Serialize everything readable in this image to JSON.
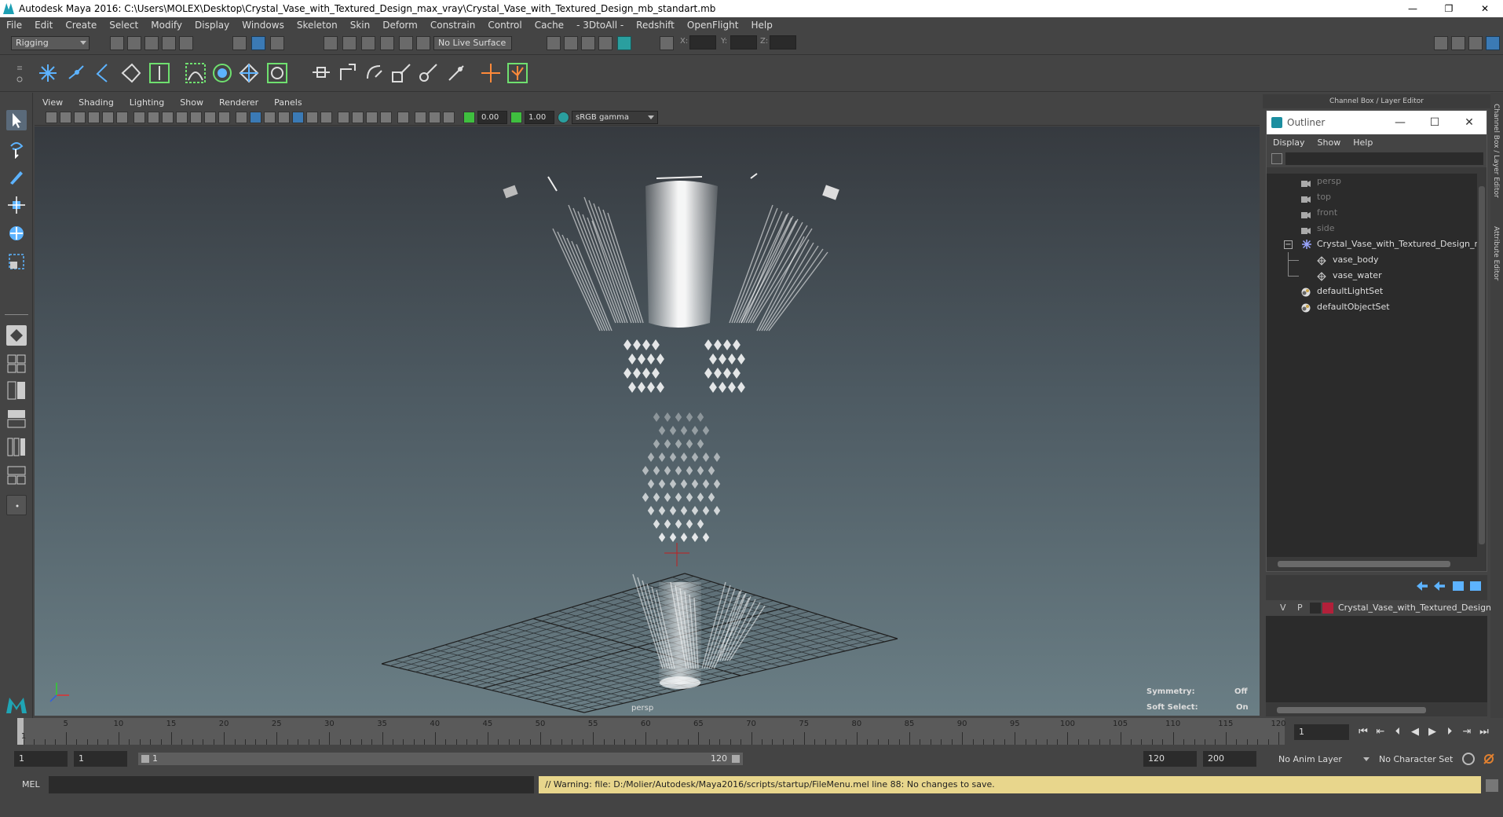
{
  "window": {
    "title": "Autodesk Maya 2016: C:\\Users\\MOLEX\\Desktop\\Crystal_Vase_with_Textured_Design_max_vray\\Crystal_Vase_with_Textured_Design_mb_standart.mb",
    "minimize": "—",
    "restore": "❐",
    "close": "✕"
  },
  "menubar": [
    "File",
    "Edit",
    "Create",
    "Select",
    "Modify",
    "Display",
    "Windows",
    "Skeleton",
    "Skin",
    "Deform",
    "Constrain",
    "Control",
    "Cache",
    "- 3DtoAll -",
    "Redshift",
    "OpenFlight",
    "Help"
  ],
  "statusline": {
    "menuset": "Rigging",
    "live_surface": "No Live Surface",
    "x_label": "X:",
    "y_label": "Y:",
    "z_label": "Z:"
  },
  "viewport": {
    "menus": [
      "View",
      "Shading",
      "Lighting",
      "Show",
      "Renderer",
      "Panels"
    ],
    "exposure": "0.00",
    "gamma": "1.00",
    "color_space": "sRGB gamma",
    "camera_label": "persp",
    "hud": {
      "symmetry_label": "Symmetry:",
      "symmetry_value": "Off",
      "soft_select_label": "Soft Select:",
      "soft_select_value": "On"
    }
  },
  "right_panel": {
    "header": "Channel Box / Layer Editor",
    "tab_channel": "Channel Box / Layer Editor",
    "tab_attr": "Attribute Editor"
  },
  "outliner": {
    "title": "Outliner",
    "btn_min": "—",
    "btn_max": "☐",
    "btn_close": "✕",
    "menus": [
      "Display",
      "Show",
      "Help"
    ],
    "items": [
      {
        "label": "persp",
        "icon": "camera-icon",
        "dim": true
      },
      {
        "label": "top",
        "icon": "camera-icon",
        "dim": true
      },
      {
        "label": "front",
        "icon": "camera-icon",
        "dim": true
      },
      {
        "label": "side",
        "icon": "camera-icon",
        "dim": true
      },
      {
        "label": "Crystal_Vase_with_Textured_Design_ncl",
        "icon": "group-icon",
        "dim": false,
        "expander": "−"
      },
      {
        "label": "vase_body",
        "icon": "mesh-icon",
        "dim": false
      },
      {
        "label": "vase_water",
        "icon": "mesh-icon",
        "dim": false
      },
      {
        "label": "defaultLightSet",
        "icon": "set-icon",
        "dim": false
      },
      {
        "label": "defaultObjectSet",
        "icon": "set-icon",
        "dim": false
      }
    ]
  },
  "layer_editor": {
    "v": "V",
    "p": "P",
    "layer_name": "Crystal_Vase_with_Textured_Design",
    "layer_color": "#b3203a"
  },
  "timeline": {
    "ticks": [
      "5",
      "10",
      "15",
      "20",
      "25",
      "30",
      "35",
      "40",
      "45",
      "50",
      "55",
      "60",
      "65",
      "70",
      "75",
      "80",
      "85",
      "90",
      "95",
      "100",
      "105",
      "110",
      "115",
      "120"
    ],
    "first_tick": "1",
    "current_frame": "1",
    "playback": [
      "⏮",
      "⇤",
      "⏴",
      "◀",
      "▶",
      "⏵",
      "⇥",
      "⏭"
    ]
  },
  "range": {
    "start": "1",
    "anim_start": "1",
    "slider_left": "1",
    "slider_right": "120",
    "anim_end": "120",
    "end": "200",
    "anim_layer": "No Anim Layer",
    "char_set": "No Character Set"
  },
  "cmdline": {
    "mode": "MEL",
    "warning": "// Warning: file: D:/Molier/Autodesk/Maya2016/scripts/startup/FileMenu.mel line 88: No changes to save."
  },
  "colors": {
    "ui_bg": "#444444",
    "viewport_top": "#363a3f",
    "viewport_bottom": "#6a7e85",
    "warning_bg": "#e8d68c",
    "accent_green": "#3fbf3f"
  }
}
